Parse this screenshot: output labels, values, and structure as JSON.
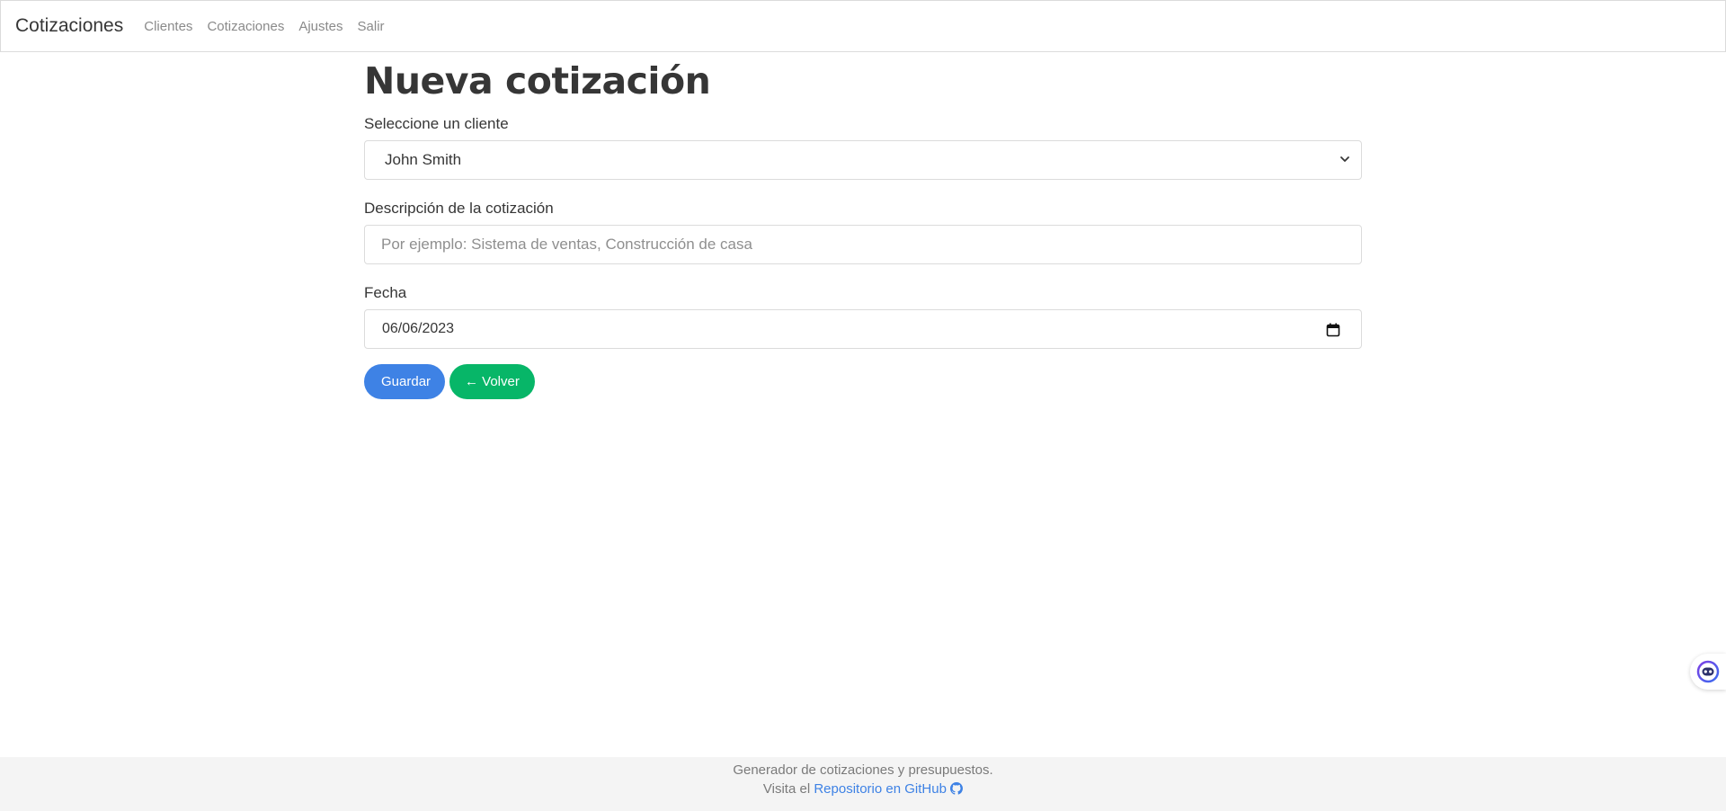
{
  "navbar": {
    "brand": "Cotizaciones",
    "links": [
      "Clientes",
      "Cotizaciones",
      "Ajustes",
      "Salir"
    ]
  },
  "main": {
    "title": "Nueva cotización",
    "client_label": "Seleccione un cliente",
    "client_value": "John Smith",
    "description_label": "Descripción de la cotización",
    "description_placeholder": "Por ejemplo: Sistema de ventas, Construcción de casa",
    "description_value": "",
    "date_label": "Fecha",
    "date_value": "06/06/2023",
    "save_button": "Guardar",
    "back_button": "← Volver"
  },
  "footer": {
    "line1": "Generador de cotizaciones y presupuestos.",
    "line2_prefix": "Visita el",
    "repo_link": "Repositorio en GitHub"
  },
  "icons": {
    "select_arrow": "chevron-down-icon",
    "date_picker": "calendar-icon",
    "repo": "github-icon",
    "widget": "assistant-icon"
  },
  "colors": {
    "primary": "#3e82e5",
    "success": "#07b668",
    "text": "#363636",
    "muted": "#8a8a8a",
    "footer_bg": "#f4f4f4"
  }
}
